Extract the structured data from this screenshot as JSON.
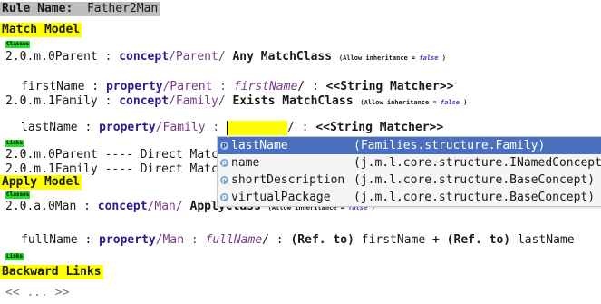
{
  "rule": {
    "label": "Rule Name:",
    "name": "Father2Man"
  },
  "match_model": {
    "title": "Match Model",
    "classes_tag": "Classes",
    "parent": {
      "id": "2.0.m.0Parent",
      "sep": " : ",
      "kw": "concept",
      "path": "/Parent/",
      "qual": "Any MatchClass",
      "inherit_label": "(Allow inheritance =",
      "inherit_value": "false",
      "inherit_close": ")"
    },
    "parent_prop": {
      "name": "firstName",
      "sep": " : ",
      "kw": "property",
      "path_a": "/Parent : ",
      "attr": "firstName",
      "path_b": "/ : ",
      "matcher": "<<String Matcher>>"
    },
    "family": {
      "id": "2.0.m.1Family",
      "sep": " : ",
      "kw": "concept",
      "path": "/Family/",
      "qual": "Exists MatchClass",
      "inherit_label": "(Allow inheritance =",
      "inherit_value": "false",
      "inherit_close": ")"
    },
    "family_prop": {
      "name": "lastName",
      "sep": " : ",
      "kw": "property",
      "path_a": "/Family : ",
      "path_b": "/ : ",
      "matcher": "<<String Matcher>>"
    },
    "links_tag": "Links",
    "links": [
      {
        "text": "2.0.m.0Parent ---- Direct Match"
      },
      {
        "text": "2.0.m.1Family ---- Direct Match"
      }
    ]
  },
  "apply_model": {
    "title": "Apply Model",
    "classes_tag": "Classes",
    "man": {
      "id": "2.0.a.0Man",
      "sep": " : ",
      "kw": "concept",
      "path": "/Man/",
      "qual": "ApplyClass",
      "inherit_label": "(Allow inheritance =",
      "inherit_value": "false",
      "inherit_close": ")"
    },
    "man_prop": {
      "name": "fullName",
      "sep": " : ",
      "kw": "property",
      "path_a": "/Man : ",
      "attr": "fullName",
      "path_b": "/ : ",
      "ref1": "(Ref. to)",
      "arg1": " firstName ",
      "plus": "+",
      "ref2": " (Ref. to)",
      "arg2": " lastName"
    },
    "links_tag": "Links"
  },
  "backward": {
    "title": "Backward Links",
    "placeholder": "<< ... >>"
  },
  "completion": {
    "items": [
      {
        "icon": "p",
        "name": "lastName",
        "type": "(Families.structure.Family)",
        "selected": true
      },
      {
        "icon": "p",
        "name": "name",
        "type": "(j.m.l.core.structure.INamedConcept)",
        "selected": false
      },
      {
        "icon": "p",
        "name": "shortDescription",
        "type": "(j.m.l.core.structure.BaseConcept)",
        "selected": false
      },
      {
        "icon": "p",
        "name": "virtualPackage",
        "type": "(j.m.l.core.structure.BaseConcept)",
        "selected": false
      }
    ]
  },
  "colors": {
    "section_bg": "#ffff00",
    "tag_bg": "#22dd22",
    "selection_bg": "#4a6fbf"
  }
}
